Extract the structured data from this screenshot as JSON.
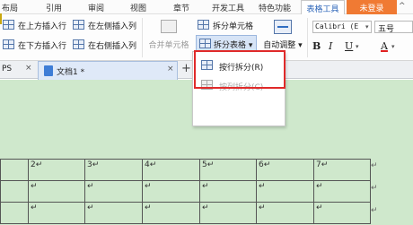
{
  "menu": {
    "items": [
      "布局",
      "引用",
      "审阅",
      "视图",
      "章节",
      "开发工具",
      "特色功能"
    ],
    "table_tools": "表格工具",
    "login": "未登录",
    "chevron": "^"
  },
  "ribbon": {
    "insert_above": "在上方插入行",
    "insert_left": "在左侧插入列",
    "insert_below": "在下方插入行",
    "insert_right": "在右侧插入列",
    "merge_cells": "合并单元格",
    "split_cells": "拆分单元格",
    "split_table": "拆分表格",
    "split_table_arrow": "▾",
    "autofit": "自动调整",
    "autofit_arrow": "▾",
    "font_name": "Calibri (E",
    "font_size": "五号",
    "bold": "B",
    "italic": "I",
    "underline": "U",
    "font_color": "A",
    "dropdown_arrow": "▾"
  },
  "tabs": {
    "previous": "PS",
    "active": "文档1 *",
    "close": "×",
    "add": "+"
  },
  "dropdown": {
    "split_by_row": "按行拆分(R)",
    "split_by_col": "按列拆分(C)"
  },
  "table": {
    "header_row": [
      "",
      "2↵",
      "3↵",
      "4↵",
      "5↵",
      "6↵",
      "7↵"
    ],
    "row": [
      "",
      "↵",
      "↵",
      "↵",
      "↵",
      "↵",
      "↵"
    ],
    "end_mark": "↵"
  },
  "colors": {
    "accent": "#2b64b8",
    "login_bg": "#f07a33",
    "doc_bg": "#cfe8cc",
    "highlight_border": "#e02a2a"
  }
}
